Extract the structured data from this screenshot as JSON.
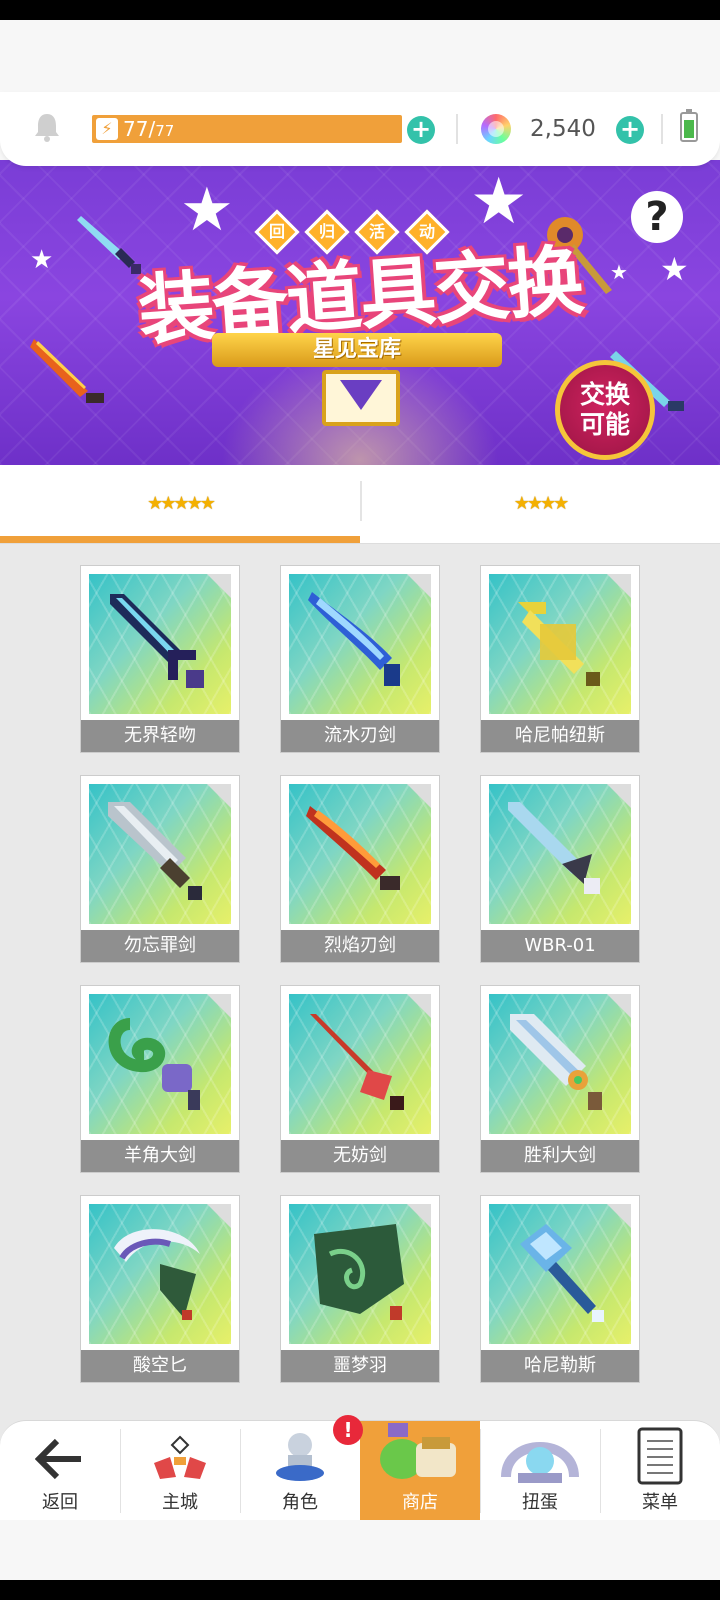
{
  "topbar": {
    "energy_current": "77",
    "energy_separator": "/",
    "energy_max": "77",
    "gems": "2,540"
  },
  "banner": {
    "event_tags": [
      "回",
      "归",
      "活",
      "动"
    ],
    "title": "装备道具交换",
    "subtitle": "星见宝库",
    "badge_line1": "交换",
    "badge_line2": "可能",
    "help": "?"
  },
  "tabs": [
    {
      "label": "★★★★★",
      "active": true
    },
    {
      "label": "★★★★",
      "active": false
    }
  ],
  "items": [
    {
      "name": "无界轻吻",
      "icon": "dark-blue-sword-icon"
    },
    {
      "name": "流水刃剑",
      "icon": "water-blade-icon"
    },
    {
      "name": "哈尼帕纽斯",
      "icon": "golden-mace-icon"
    },
    {
      "name": "勿忘罪剑",
      "icon": "grey-greatsword-icon"
    },
    {
      "name": "烈焰刃剑",
      "icon": "flame-blade-icon"
    },
    {
      "name": "WBR-01",
      "icon": "tech-sword-icon"
    },
    {
      "name": "羊角大剑",
      "icon": "ram-horn-sword-icon"
    },
    {
      "name": "无妨剑",
      "icon": "red-rapier-icon"
    },
    {
      "name": "胜利大剑",
      "icon": "victory-greatsword-icon"
    },
    {
      "name": "酸空匕",
      "icon": "scythe-dagger-icon"
    },
    {
      "name": "噩梦羽",
      "icon": "nightmare-feather-icon"
    },
    {
      "name": "哈尼勒斯",
      "icon": "ice-hammer-icon"
    }
  ],
  "nav": [
    {
      "label": "返回",
      "icon": "back-arrow-icon"
    },
    {
      "label": "主城",
      "icon": "castle-icon"
    },
    {
      "label": "角色",
      "icon": "character-icon"
    },
    {
      "label": "商店",
      "icon": "shop-bag-icon",
      "active": true
    },
    {
      "label": "扭蛋",
      "icon": "gacha-icon"
    },
    {
      "label": "菜单",
      "icon": "menu-list-icon"
    }
  ],
  "alert_badge": "!",
  "colors": {
    "accent": "#f0a03a",
    "plus": "#33c2aa",
    "banner_purple": "#7a3dd6",
    "item_label_bg": "#8f8f8f"
  }
}
